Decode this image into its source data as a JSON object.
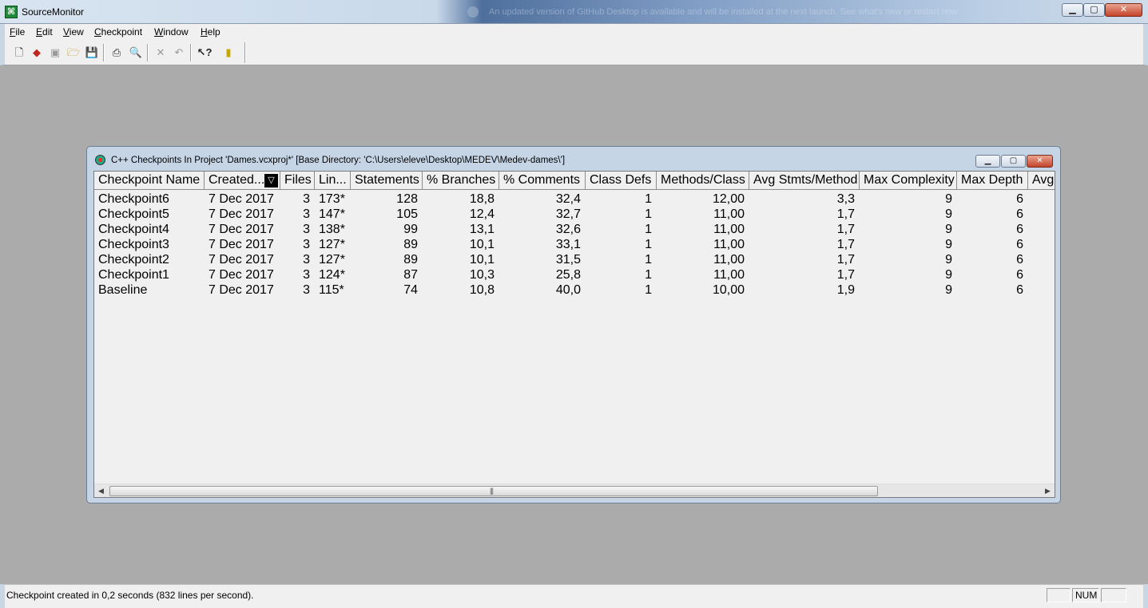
{
  "window": {
    "title": "SourceMonitor",
    "notification": "An updated version of GitHub Desktop is available and will be installed at the next launch. See what's new or restart now"
  },
  "menu": [
    "File",
    "Edit",
    "View",
    "Checkpoint",
    "Window",
    "Help"
  ],
  "toolbar": [
    "new-file-icon",
    "new-project-icon",
    "checkpoint-icon",
    "open-folder-icon",
    "save-icon",
    "print-icon",
    "print-preview-icon",
    "delete-icon",
    "undo-icon",
    "context-help-icon",
    "bookmark-icon"
  ],
  "child": {
    "title": "C++ Checkpoints In Project 'Dames.vcxproj*'  [Base Directory: 'C:\\Users\\eleve\\Desktop\\MEDEV\\Medev-dames\\']"
  },
  "table": {
    "sort_indicator": "▽",
    "columns": [
      "Checkpoint Name",
      "Created...",
      "Files",
      "Lin...",
      "Statements",
      "% Branches",
      "% Comments",
      "Class Defs",
      "Methods/Class",
      "Avg Stmts/Method",
      "Max Complexity",
      "Max Depth",
      "Avg"
    ],
    "rows": [
      [
        "Checkpoint6",
        "7 Dec 2017",
        "3",
        "173*",
        "128",
        "18,8",
        "32,4",
        "1",
        "12,00",
        "3,3",
        "9",
        "6"
      ],
      [
        "Checkpoint5",
        "7 Dec 2017",
        "3",
        "147*",
        "105",
        "12,4",
        "32,7",
        "1",
        "11,00",
        "1,7",
        "9",
        "6"
      ],
      [
        "Checkpoint4",
        "7 Dec 2017",
        "3",
        "138*",
        "99",
        "13,1",
        "32,6",
        "1",
        "11,00",
        "1,7",
        "9",
        "6"
      ],
      [
        "Checkpoint3",
        "7 Dec 2017",
        "3",
        "127*",
        "89",
        "10,1",
        "33,1",
        "1",
        "11,00",
        "1,7",
        "9",
        "6"
      ],
      [
        "Checkpoint2",
        "7 Dec 2017",
        "3",
        "127*",
        "89",
        "10,1",
        "31,5",
        "1",
        "11,00",
        "1,7",
        "9",
        "6"
      ],
      [
        "Checkpoint1",
        "7 Dec 2017",
        "3",
        "124*",
        "87",
        "10,3",
        "25,8",
        "1",
        "11,00",
        "1,7",
        "9",
        "6"
      ],
      [
        "Baseline",
        "7 Dec 2017",
        "3",
        "115*",
        "74",
        "10,8",
        "40,0",
        "1",
        "10,00",
        "1,9",
        "9",
        "6"
      ]
    ]
  },
  "statusbar": {
    "message": "Checkpoint created in 0,2 seconds (832 lines per second).",
    "num": "NUM"
  }
}
